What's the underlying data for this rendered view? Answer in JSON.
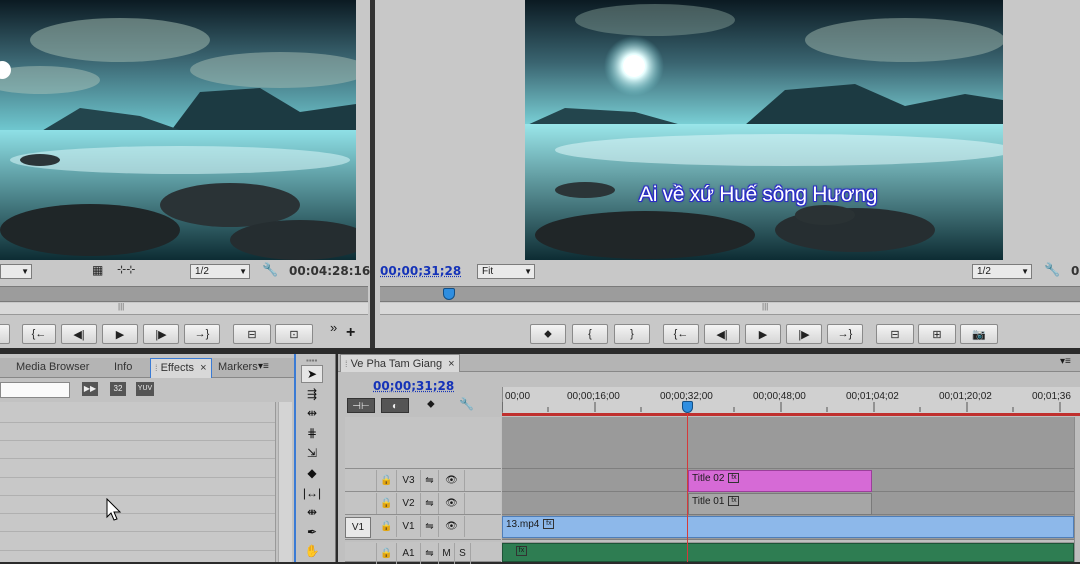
{
  "source_monitor": {
    "zoom": "1/2",
    "timecode": "00:04:28:16"
  },
  "program_monitor": {
    "timecode": "00;00;31;28",
    "fit": "Fit",
    "zoom": "1/2",
    "subtitle": "Ai về xứ Huế sông Hương",
    "right_edge_char": "0"
  },
  "left_panel": {
    "tabs": [
      "Media Browser",
      "Info",
      "Effects",
      "Markers"
    ],
    "active_tab": "Effects",
    "close_glyph": "×",
    "menu_glyph": "▾≡",
    "badge_32": "32",
    "badge_yuv": "YUV"
  },
  "timeline": {
    "sequence_name": "Ve Pha Tam Giang",
    "close_glyph": "×",
    "timecode": "00;00;31;28",
    "ruler_labels": [
      "00;00",
      "00;00;16;00",
      "00;00;32;00",
      "00;00;48;00",
      "00;01;04;02",
      "00;01;20;02",
      "00;01;36"
    ],
    "tracks": [
      {
        "source": "",
        "name": "V3",
        "type": "video"
      },
      {
        "source": "",
        "name": "V2",
        "type": "video"
      },
      {
        "source": "V1",
        "name": "V1",
        "type": "video"
      },
      {
        "source": "",
        "name": "A1",
        "type": "audio",
        "m": "M",
        "s": "S"
      }
    ],
    "clips": [
      {
        "label": "Title 02",
        "fx": "fx",
        "track": "V3"
      },
      {
        "label": "Title 01",
        "fx": "fx",
        "track": "V2"
      },
      {
        "label": "13.mp4",
        "fx": "fx",
        "track": "V1"
      },
      {
        "label": "",
        "fx": "fx",
        "track": "A1"
      }
    ]
  },
  "transport_glyphs": {
    "mark_in": "{",
    "mark_out": "}",
    "goto_in": "{←",
    "step_back": "◀|",
    "play": "▶",
    "step_fwd": "|▶",
    "goto_out": "→}",
    "marker": "⬥",
    "more": "»",
    "add": "+"
  },
  "colors": {
    "timecode_blue": "#1533b8",
    "title_clip": "#d66ad6",
    "video_clip": "#8db8ea",
    "audio_clip": "#2e7d52",
    "playhead": "#d43a3a",
    "workarea_bar": "#c0302e"
  }
}
